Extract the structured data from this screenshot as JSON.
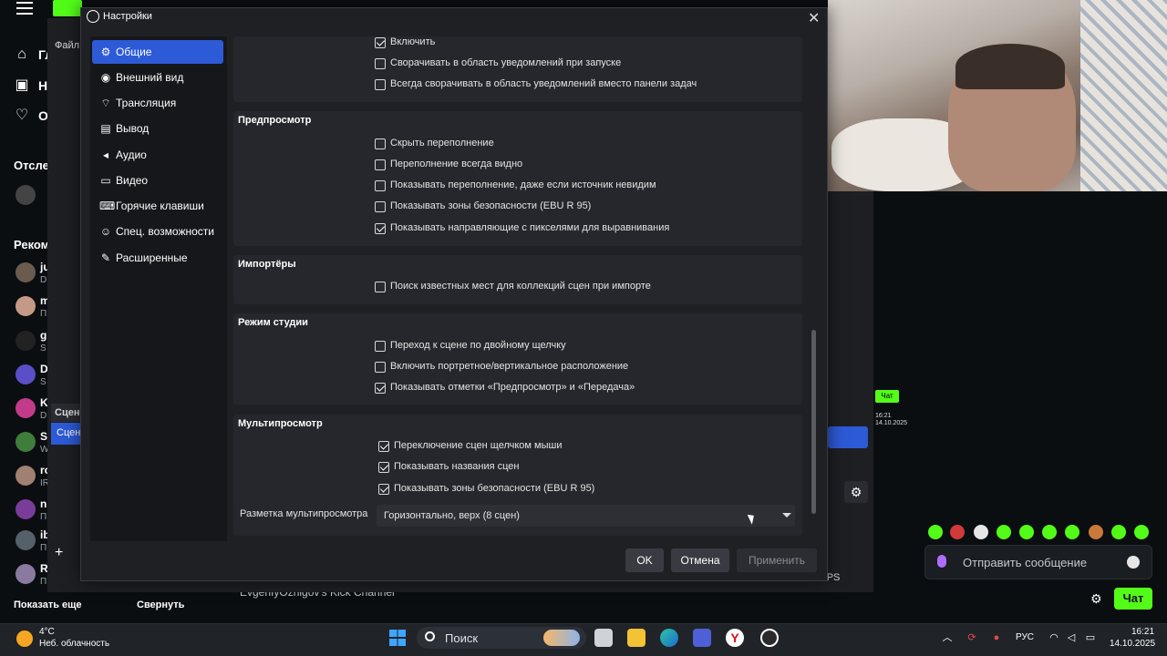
{
  "background_app": {
    "nav": [
      "Гл",
      "Н",
      "О"
    ],
    "following_header": "Отсле",
    "recommended_header": "Реком",
    "channels": [
      {
        "name": "ju",
        "sub": "D"
      },
      {
        "name": "m",
        "sub": "П"
      },
      {
        "name": "g",
        "sub": "S"
      },
      {
        "name": "D",
        "sub": "S"
      },
      {
        "name": "K",
        "sub": "D"
      },
      {
        "name": "S",
        "sub": "W"
      },
      {
        "name": "ro",
        "sub": "IR"
      },
      {
        "name": "n",
        "sub": "П"
      },
      {
        "name": "ib",
        "sub": "П"
      },
      {
        "name": "R",
        "sub": "П"
      }
    ],
    "show_more": "Показать еще",
    "collapse": "Свернуть",
    "channel_title": "EvgenIyOznigov's Kick Channel",
    "obs_scene_header": "Сцен",
    "obs_scene_item": "Сцен",
    "obs_file_menu": "Файл",
    "fps": "FPS",
    "chat_small_btn": "Чат",
    "chat_input_placeholder": "Отправить сообщение",
    "chat_button": "Чат",
    "accent": "#53fc18"
  },
  "dialog": {
    "title": "Настройки",
    "nav": [
      {
        "label": "Общие",
        "icon": "gear-icon",
        "active": true
      },
      {
        "label": "Внешний вид",
        "icon": "appearance-icon",
        "active": false
      },
      {
        "label": "Трансляция",
        "icon": "antenna-icon",
        "active": false
      },
      {
        "label": "Вывод",
        "icon": "output-icon",
        "active": false
      },
      {
        "label": "Аудио",
        "icon": "speaker-icon",
        "active": false
      },
      {
        "label": "Видео",
        "icon": "monitor-icon",
        "active": false
      },
      {
        "label": "Горячие клавиши",
        "icon": "keyboard-icon",
        "active": false
      },
      {
        "label": "Спец. возможности",
        "icon": "accessibility-icon",
        "active": false
      },
      {
        "label": "Расширенные",
        "icon": "wrench-icon",
        "active": false
      }
    ],
    "tray_group": [
      {
        "label": "Включить",
        "checked": true
      },
      {
        "label": "Сворачивать в область уведомлений при запуске",
        "checked": false
      },
      {
        "label": "Всегда сворачивать в область уведомлений вместо панели задач",
        "checked": false
      }
    ],
    "preview_group": {
      "title": "Предпросмотр",
      "items": [
        {
          "label": "Скрыть переполнение",
          "checked": false
        },
        {
          "label": "Переполнение всегда видно",
          "checked": false
        },
        {
          "label": "Показывать переполнение, даже если источник невидим",
          "checked": false
        },
        {
          "label": "Показывать зоны безопасности (EBU R 95)",
          "checked": false
        },
        {
          "label": "Показывать направляющие с пикселями для выравнивания",
          "checked": true
        }
      ]
    },
    "importers_group": {
      "title": "Импортёры",
      "items": [
        {
          "label": "Поиск известных мест для коллекций сцен при импорте",
          "checked": false
        }
      ]
    },
    "studio_group": {
      "title": "Режим студии",
      "items": [
        {
          "label": "Переход к сцене по двойному щелчку",
          "checked": false
        },
        {
          "label": "Включить портретное/вертикальное расположение",
          "checked": false
        },
        {
          "label": "Показывать отметки «Предпросмотр» и «Передача»",
          "checked": true
        }
      ]
    },
    "multiview_group": {
      "title": "Мультипросмотр",
      "items": [
        {
          "label": "Переключение сцен щелчком мыши",
          "checked": true
        },
        {
          "label": "Показывать названия сцен",
          "checked": true
        },
        {
          "label": "Показывать зоны безопасности (EBU R 95)",
          "checked": true
        }
      ],
      "layout_label": "Разметка мультипросмотра",
      "layout_value": "Горизонтально, верх (8 сцен)"
    },
    "buttons": {
      "ok": "OK",
      "cancel": "Отмена",
      "apply": "Применить"
    }
  },
  "taskbar": {
    "temperature": "4°C",
    "weather": "Неб. облачность",
    "search": "Поиск",
    "lang": "РУС",
    "time": "16:21",
    "date": "14.10.2025"
  },
  "mini_clock": {
    "time": "16:21",
    "date": "14.10.2025"
  }
}
